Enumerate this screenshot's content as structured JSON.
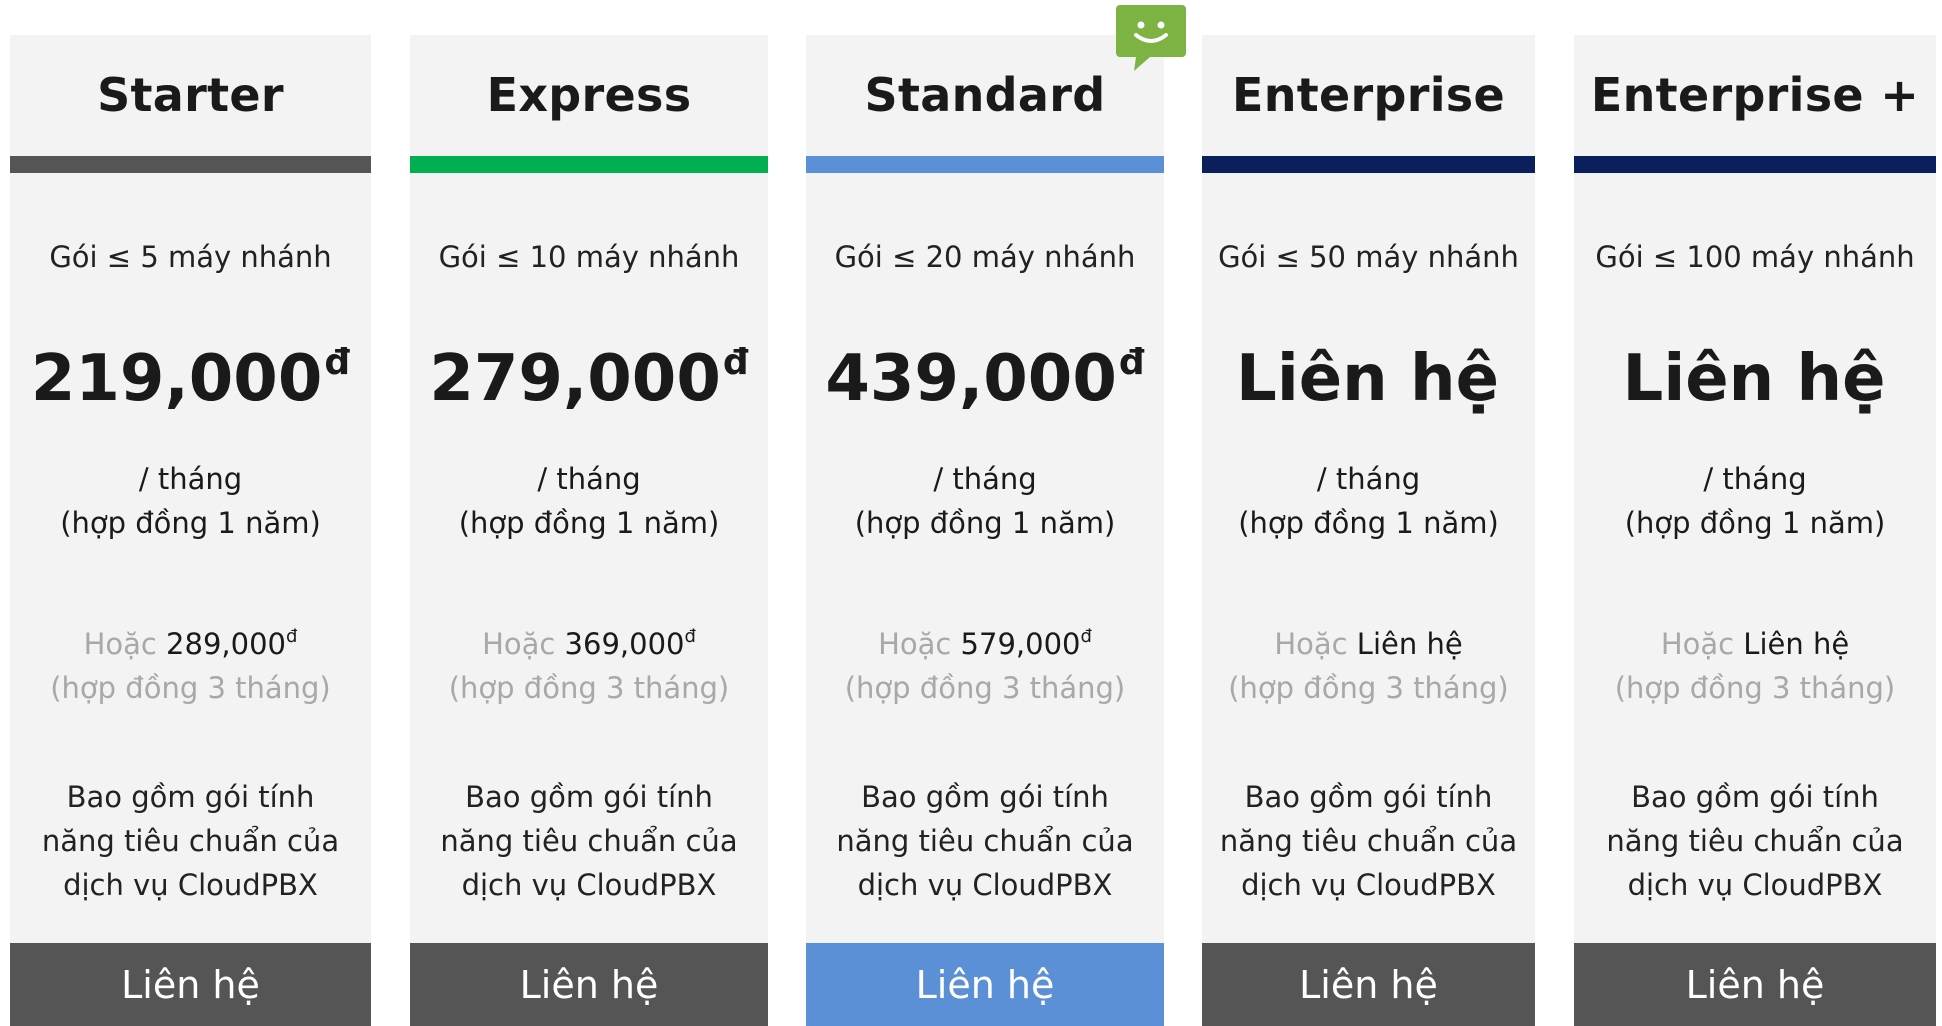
{
  "colors": {
    "card_bg": "#f3f3f3",
    "cta_default": "#555555",
    "cta_highlight": "#5b8fd6",
    "badge_green": "#7cb342"
  },
  "plans": [
    {
      "name": "Starter",
      "extensions": "Gói ≤ 5 máy nhánh",
      "price": "219,000",
      "currency": "đ",
      "period": "/ tháng",
      "contract": "(hợp đồng 1 năm)",
      "alt_prefix": "Hoặc",
      "alt_price": "289,000",
      "alt_currency": "đ",
      "alt_contract": "(hợp đồng 3 tháng)",
      "desc_line1": "Bao gồm gói tính",
      "desc_line2": "năng tiêu chuẩn của",
      "desc_line3": "dịch vụ CloudPBX",
      "cta": "Liên hệ",
      "accent": "#555555"
    },
    {
      "name": "Express",
      "extensions": "Gói ≤ 10 máy nhánh",
      "price": "279,000",
      "currency": "đ",
      "period": "/ tháng",
      "contract": "(hợp đồng 1 năm)",
      "alt_prefix": "Hoặc",
      "alt_price": "369,000",
      "alt_currency": "đ",
      "alt_contract": "(hợp đồng 3 tháng)",
      "desc_line1": "Bao gồm gói tính",
      "desc_line2": "năng tiêu chuẩn của",
      "desc_line3": "dịch vụ CloudPBX",
      "cta": "Liên hệ",
      "accent": "#00b050"
    },
    {
      "name": "Standard",
      "extensions": "Gói ≤ 20 máy nhánh",
      "price": "439,000",
      "currency": "đ",
      "period": "/ tháng",
      "contract": "(hợp đồng 1 năm)",
      "alt_prefix": "Hoặc",
      "alt_price": "579,000",
      "alt_currency": "đ",
      "alt_contract": "(hợp đồng 3 tháng)",
      "desc_line1": "Bao gồm gói tính",
      "desc_line2": "năng tiêu chuẩn của",
      "desc_line3": "dịch vụ CloudPBX",
      "cta": "Liên hệ",
      "accent": "#5b8fd6"
    },
    {
      "name": "Enterprise",
      "extensions": "Gói ≤ 50 máy nhánh",
      "price": "Liên hệ",
      "currency": "",
      "period": "/ tháng",
      "contract": "(hợp đồng 1 năm)",
      "alt_prefix": "Hoặc",
      "alt_price": "Liên hệ",
      "alt_currency": "",
      "alt_contract": "(hợp đồng 3 tháng)",
      "desc_line1": "Bao gồm gói tính",
      "desc_line2": "năng tiêu chuẩn của",
      "desc_line3": "dịch vụ CloudPBX",
      "cta": "Liên hệ",
      "accent": "#0b1f5c"
    },
    {
      "name": "Enterprise +",
      "extensions": "Gói ≤ 100 máy nhánh",
      "price": "Liên hệ",
      "currency": "",
      "period": "/ tháng",
      "contract": "(hợp đồng 1 năm)",
      "alt_prefix": "Hoặc",
      "alt_price": "Liên hệ",
      "alt_currency": "",
      "alt_contract": "(hợp đồng 3 tháng)",
      "desc_line1": "Bao gồm gói tính",
      "desc_line2": "năng tiêu chuẩn của",
      "desc_line3": "dịch vụ CloudPBX",
      "cta": "Liên hệ",
      "accent": "#0b1f5c"
    }
  ],
  "badge_icon": "smiley-chat-icon"
}
